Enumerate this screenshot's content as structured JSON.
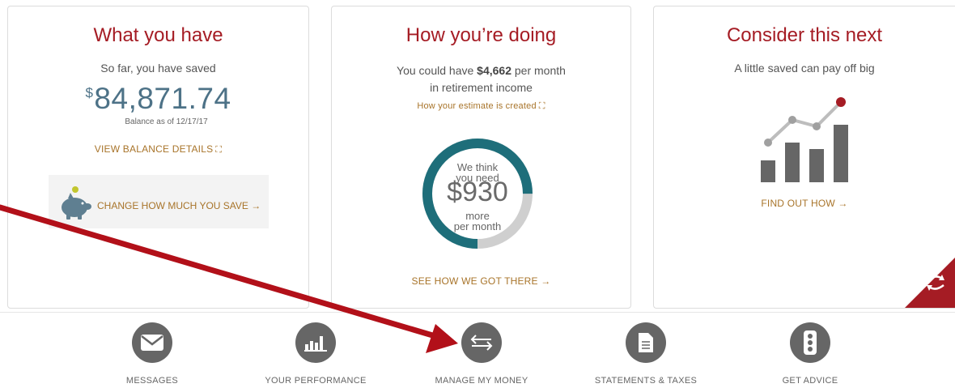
{
  "cards": {
    "what_you_have": {
      "title": "What you have",
      "subtitle": "So far, you have saved",
      "currency_symbol": "$",
      "balance": "84,871.74",
      "balance_date": "Balance as of 12/17/17",
      "view_details_label": "VIEW BALANCE DETAILS",
      "view_details_icon": "expand-icon",
      "change_save_label": "CHANGE HOW MUCH YOU SAVE →",
      "piggy_icon": "piggy-bank-icon"
    },
    "how_youre_doing": {
      "title": "How you’re doing",
      "income_prefix": "You could have ",
      "income_amount": "$4,662",
      "income_suffix": " per month",
      "income_line2": "in retirement income",
      "estimate_link": "How your estimate is created",
      "donut_line1": "We think",
      "donut_line2": "you need",
      "donut_value": "$930",
      "donut_line3": "more",
      "donut_line4": "per month",
      "donut_progress": 0.75,
      "see_how_label": "SEE HOW WE GOT THERE →"
    },
    "consider_next": {
      "title": "Consider this next",
      "subtitle": "A little saved can pay off big",
      "find_out_label": "FIND OUT HOW →",
      "chart_icon": "growth-chart-icon",
      "refresh_icon": "refresh-icon"
    }
  },
  "nav": [
    {
      "label": "MESSAGES",
      "icon": "envelope-icon"
    },
    {
      "label": "YOUR PERFORMANCE",
      "icon": "bar-chart-icon"
    },
    {
      "label": "MANAGE MY MONEY",
      "icon": "transfer-arrows-icon"
    },
    {
      "label": "STATEMENTS & TAXES",
      "icon": "document-icon"
    },
    {
      "label": "GET ADVICE",
      "icon": "traffic-light-icon"
    }
  ],
  "colors": {
    "title_red": "#a51c24",
    "balance_blue": "#4d7287",
    "link_gold": "#a8742a",
    "donut_teal": "#1e6e7a",
    "donut_remaining": "#cfcfcf",
    "icon_gray": "#666666",
    "annotation_arrow": "#b21019"
  }
}
